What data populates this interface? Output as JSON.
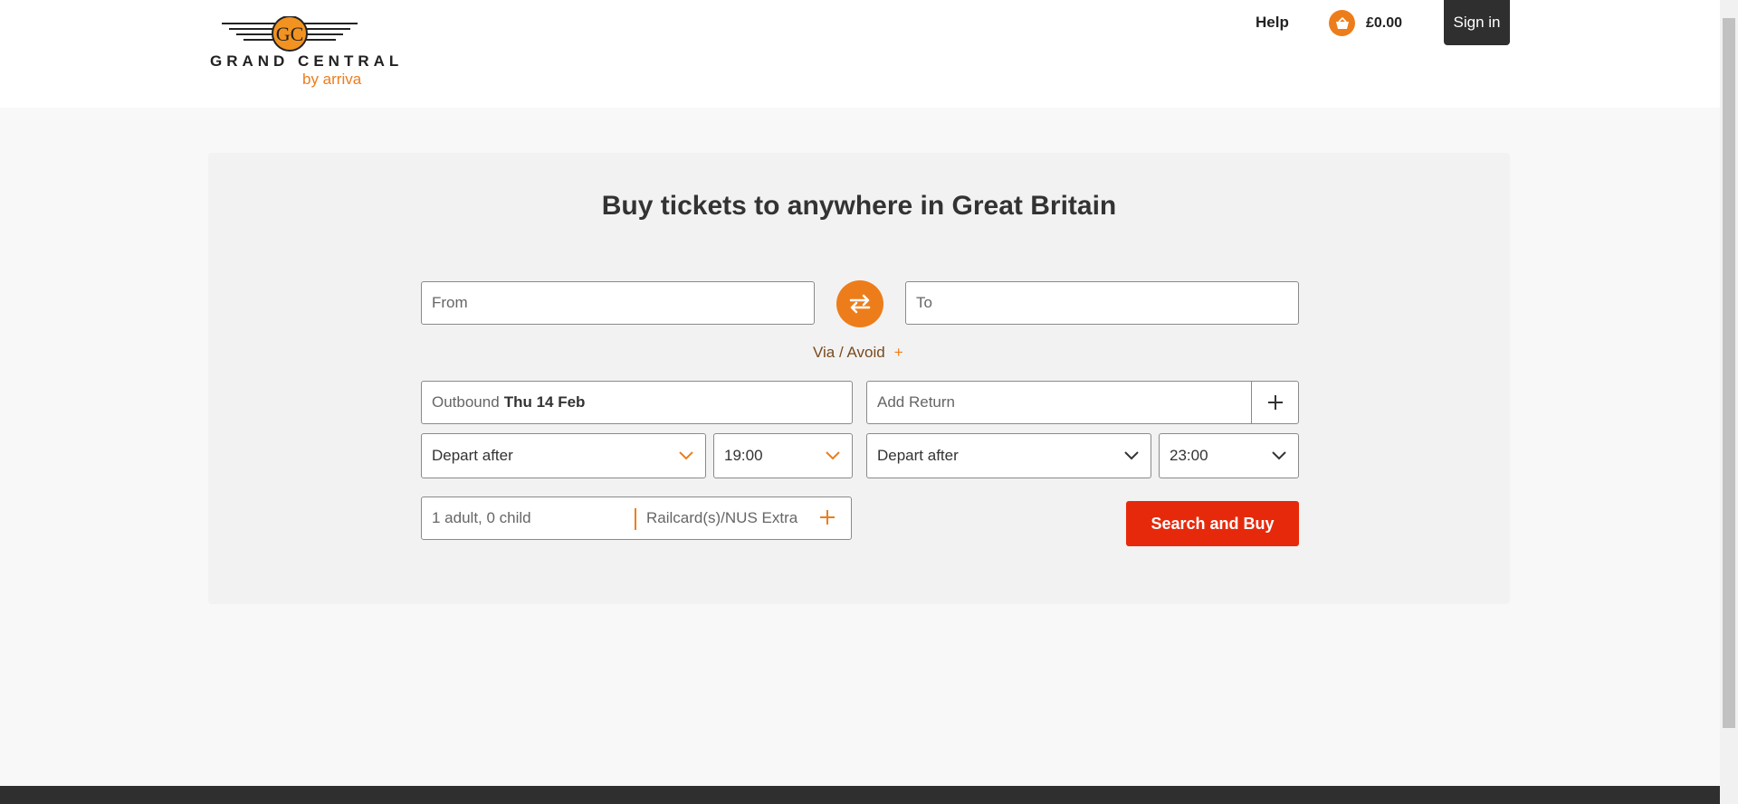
{
  "header": {
    "logo_monogram": "GC",
    "logo_brand": "GRAND CENTRAL",
    "logo_sub": "by arriva",
    "help_label": "Help",
    "basket_total": "£0.00",
    "signin_label": "Sign in"
  },
  "search": {
    "title": "Buy tickets to anywhere in Great Britain",
    "from_placeholder": "From",
    "to_placeholder": "To",
    "via_label": "Via / Avoid",
    "via_plus": "+",
    "outbound_label": "Outbound",
    "outbound_date": "Thu 14 Feb",
    "return_label": "Add Return",
    "outbound_depart_type": "Depart after",
    "outbound_time": "19:00",
    "return_depart_type": "Depart after",
    "return_time": "23:00",
    "passengers": "1 adult, 0 child",
    "railcard_label": "Railcard(s)/NUS Extra",
    "search_button": "Search and Buy"
  },
  "colors": {
    "accent": "#ed7d1b",
    "search_button": "#e7290b",
    "dark": "#2f2f2f"
  },
  "icons": [
    "basket-icon",
    "swap-icon",
    "plus-icon",
    "chevron-down-icon"
  ]
}
